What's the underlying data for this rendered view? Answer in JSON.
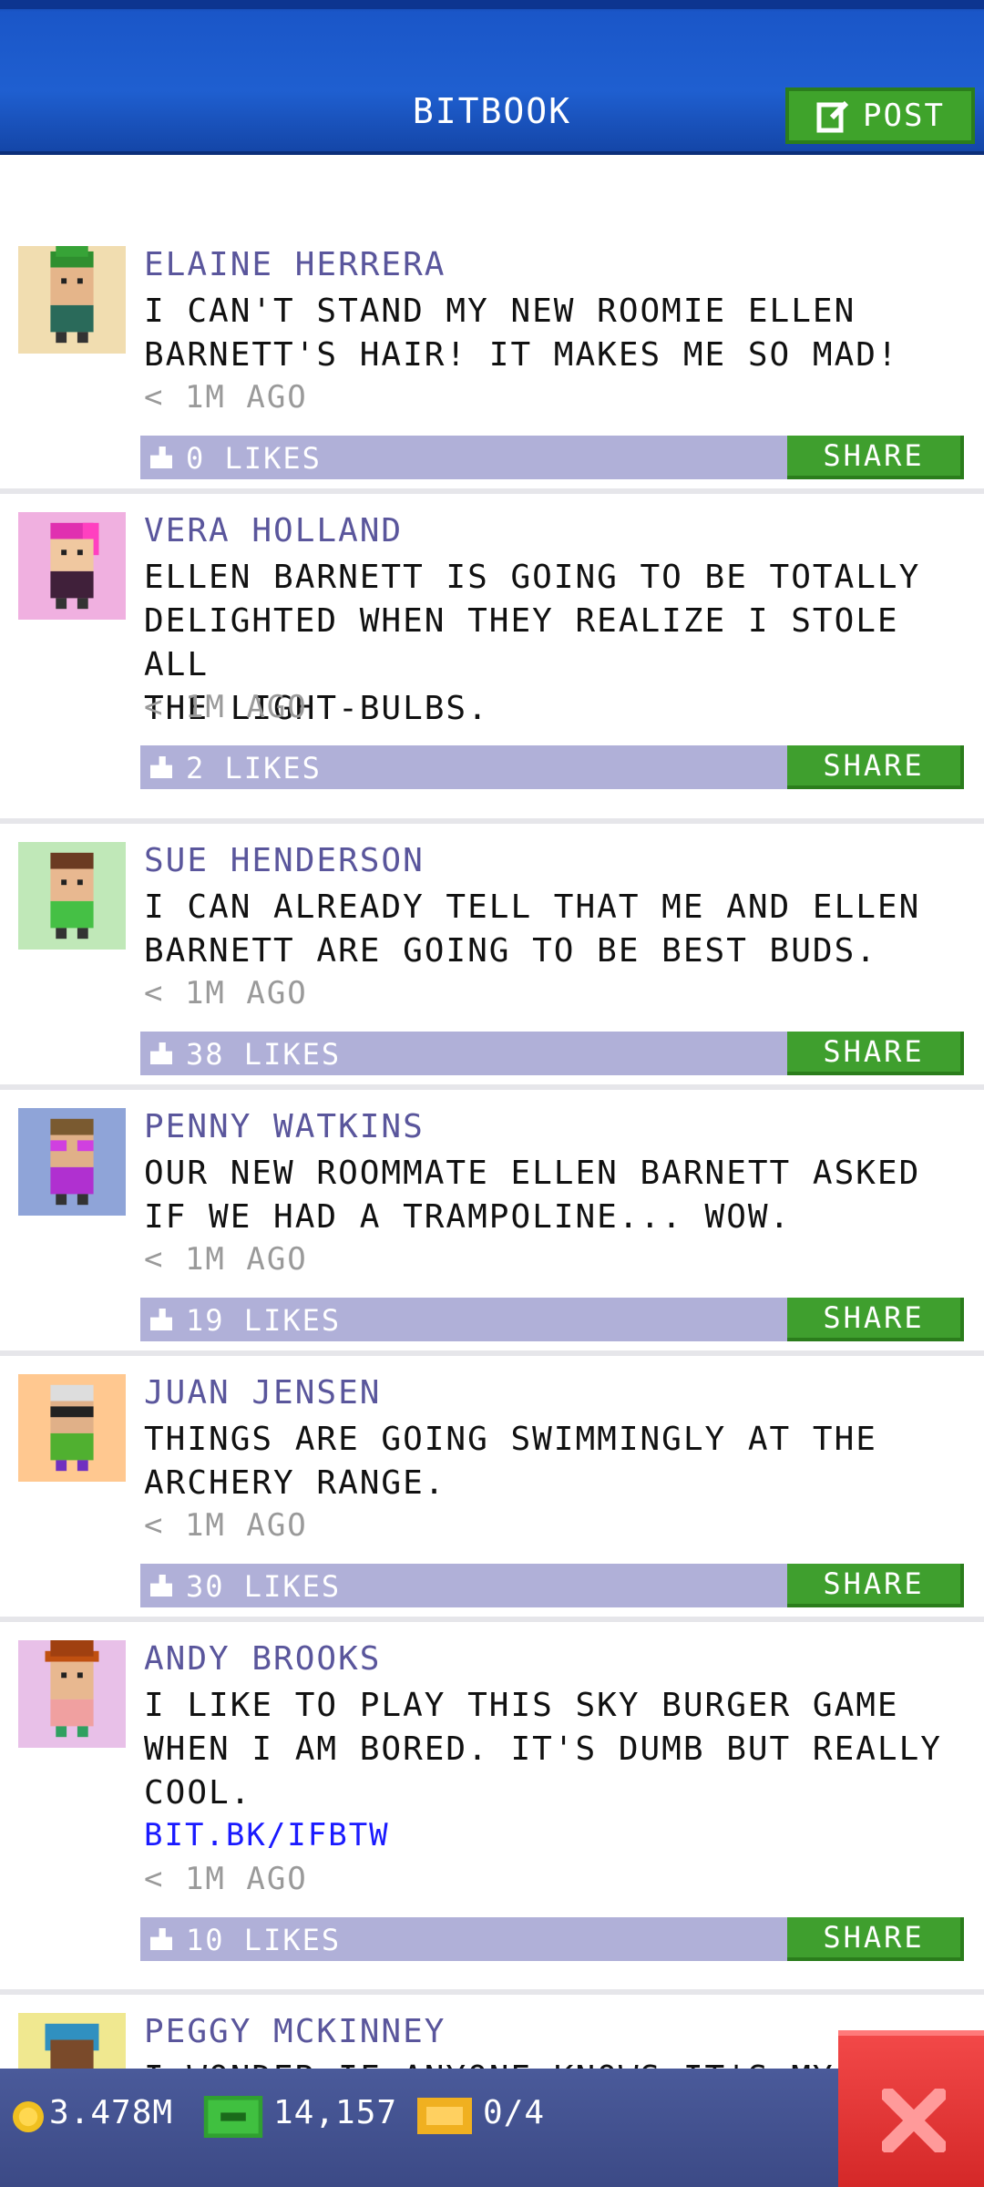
{
  "header": {
    "title": "BITBOOK",
    "post_label": "POST"
  },
  "posts": [
    {
      "name": "ELAINE HERRERA",
      "text": "I CAN'T STAND MY NEW ROOMIE ELLEN\nBARNETT'S HAIR! IT MAKES ME SO MAD!",
      "time": "< 1M AGO",
      "likes": "0 LIKES",
      "share": "SHARE"
    },
    {
      "name": "VERA HOLLAND",
      "text": "ELLEN BARNETT IS GOING TO BE TOTALLY\nDELIGHTED WHEN THEY REALIZE I STOLE ALL\nTHE LIGHT-BULBS.",
      "time": "< 1M AGO",
      "likes": "2 LIKES",
      "share": "SHARE"
    },
    {
      "name": "SUE HENDERSON",
      "text": "I CAN ALREADY TELL THAT ME AND ELLEN\nBARNETT ARE GOING TO BE BEST BUDS.",
      "time": "< 1M AGO",
      "likes": "38 LIKES",
      "share": "SHARE"
    },
    {
      "name": "PENNY WATKINS",
      "text": "OUR NEW ROOMMATE ELLEN BARNETT ASKED\nIF WE HAD A TRAMPOLINE... WOW.",
      "time": "< 1M AGO",
      "likes": "19 LIKES",
      "share": "SHARE"
    },
    {
      "name": "JUAN JENSEN",
      "text": "THINGS ARE GOING SWIMMINGLY AT THE\nARCHERY RANGE.",
      "time": "< 1M AGO",
      "likes": "30 LIKES",
      "share": "SHARE"
    },
    {
      "name": "ANDY BROOKS",
      "text": "I LIKE TO PLAY THIS SKY BURGER GAME\nWHEN I AM BORED. IT'S DUMB BUT REALLY\nCOOL.",
      "link": "BIT.BK/IFBTW",
      "time": "< 1M AGO",
      "likes": "10 LIKES",
      "share": "SHARE"
    },
    {
      "name": "PEGGY MCKINNEY",
      "text": "I WONDER IF ANYONE KNOWS IT'S MY"
    }
  ],
  "status": {
    "coins": "3.478M",
    "bux": "14,157",
    "tickets": "0/4"
  },
  "colors": {
    "header_blue": "#1f5fd0",
    "accent_green": "#3fa32b",
    "like_bar": "#b0b0d8",
    "name_purple": "#5a569c",
    "close_red": "#e23a3a"
  },
  "icons": [
    "edit-icon",
    "thumbs-up-icon",
    "coin-icon",
    "bux-icon",
    "ticket-icon",
    "close-icon"
  ]
}
